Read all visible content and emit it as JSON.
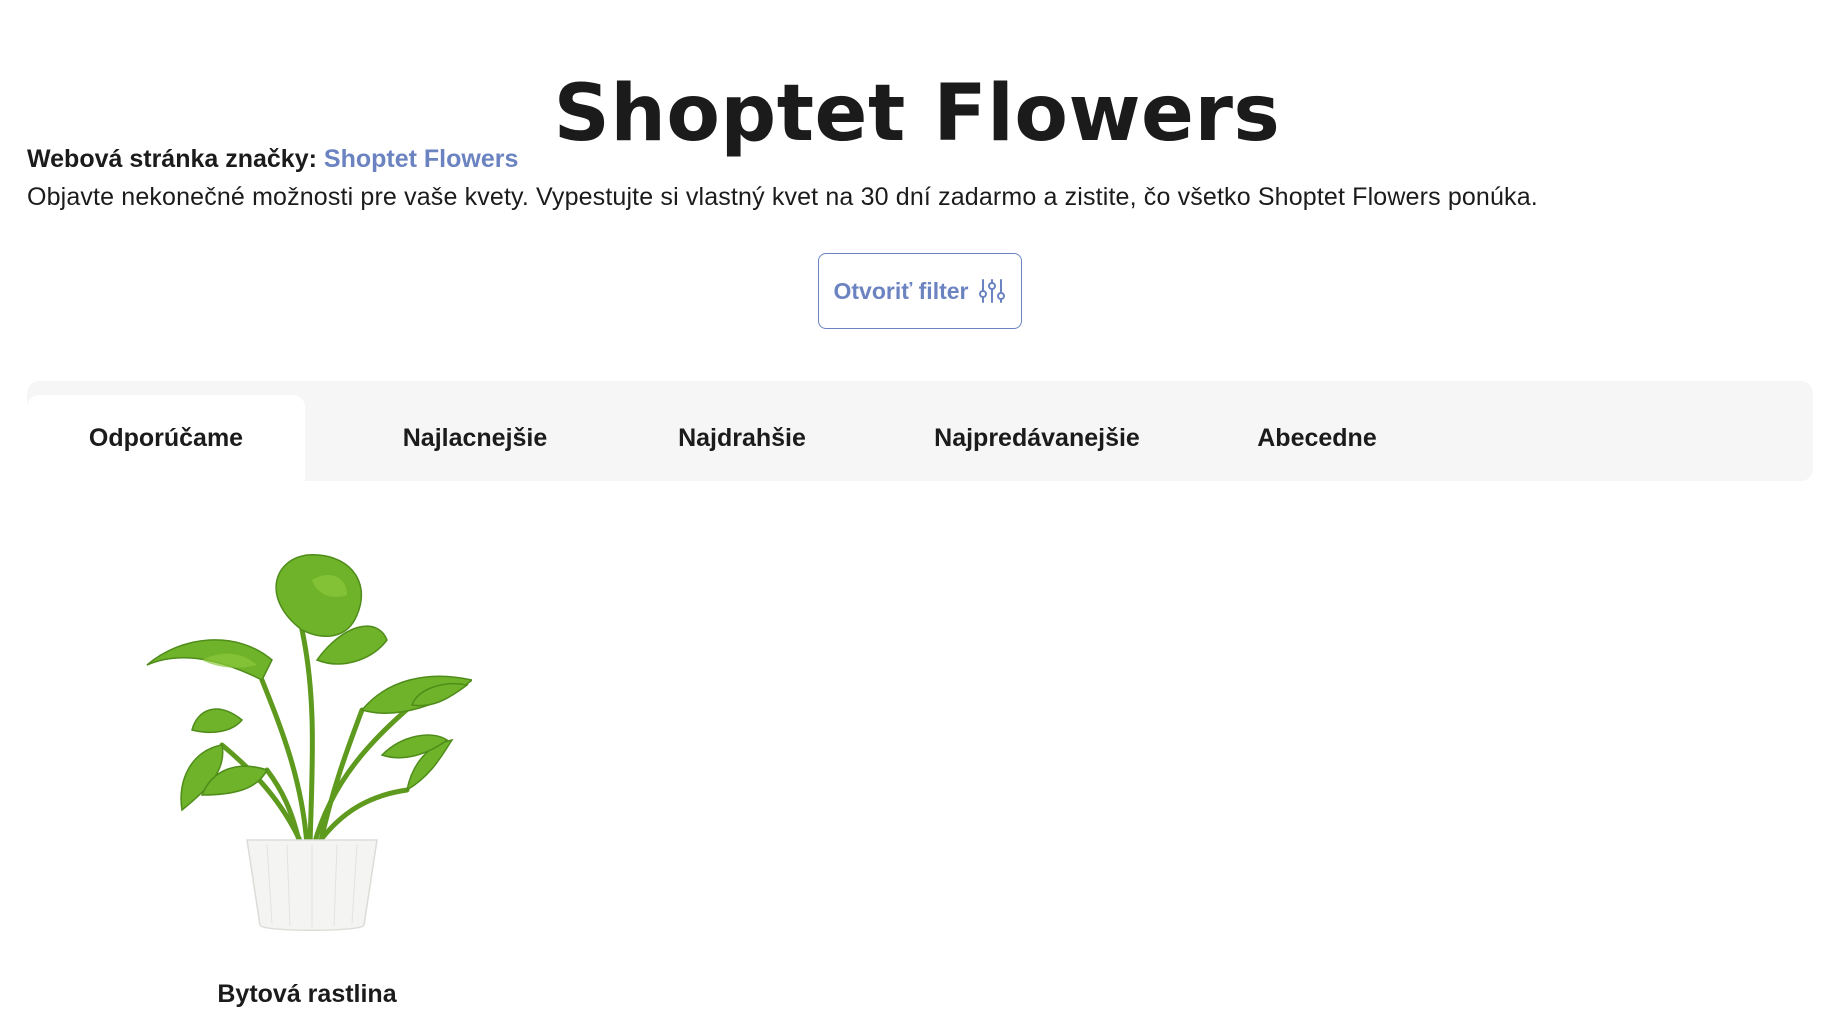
{
  "header": {
    "title": "Shoptet Flowers"
  },
  "brand": {
    "label": "Webová stránka značky:",
    "link_text": "Shoptet Flowers",
    "link_color": "#6b83c0"
  },
  "description": "Objavte nekonečné možnosti pre vaše kvety. Vypestujte si vlastný kvet na 30 dní zadarmo a zistite, čo všetko Shoptet Flowers ponúka.",
  "filter": {
    "label": "Otvoriť filter",
    "icon": "sliders-icon"
  },
  "sort_tabs": {
    "items": [
      {
        "label": "Odporúčame",
        "active": true
      },
      {
        "label": "Najlacnejšie",
        "active": false
      },
      {
        "label": "Najdrahšie",
        "active": false
      },
      {
        "label": "Najpredávanejšie",
        "active": false
      },
      {
        "label": "Abecedne",
        "active": false
      }
    ]
  },
  "products": [
    {
      "name": "Bytová rastlina",
      "image": "potted-monstera-plant"
    }
  ],
  "colors": {
    "accent": "#6b83c0",
    "text": "#1b1b1b",
    "tab_bar_bg": "#f6f6f6"
  }
}
